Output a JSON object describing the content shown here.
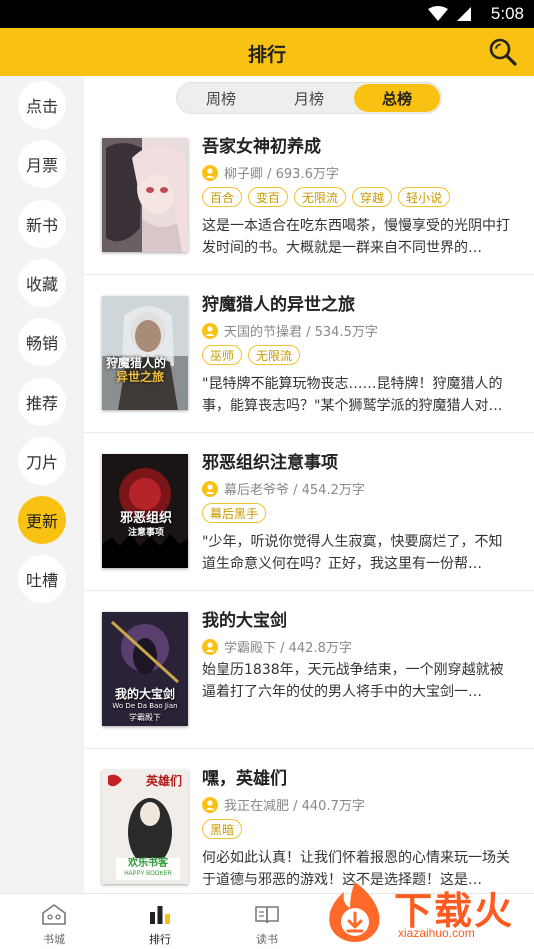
{
  "status_bar": {
    "time": "5:08"
  },
  "header": {
    "title": "排行"
  },
  "sidebar": {
    "items": [
      {
        "label": "点击",
        "active": false
      },
      {
        "label": "月票",
        "active": false
      },
      {
        "label": "新书",
        "active": false
      },
      {
        "label": "收藏",
        "active": false
      },
      {
        "label": "畅销",
        "active": false
      },
      {
        "label": "推荐",
        "active": false
      },
      {
        "label": "刀片",
        "active": false
      },
      {
        "label": "更新",
        "active": true
      },
      {
        "label": "吐槽",
        "active": false
      }
    ]
  },
  "segment": {
    "tabs": [
      {
        "label": "周榜",
        "active": false
      },
      {
        "label": "月榜",
        "active": false
      },
      {
        "label": "总榜",
        "active": true
      }
    ]
  },
  "books": [
    {
      "title": "吾家女神初养成",
      "author": "柳子卿 / 693.6万字",
      "tags": [
        "百合",
        "变百",
        "无限流",
        "穿越",
        "轻小说"
      ],
      "description": "这是一本适合在吃东西喝茶，慢慢享受的光阴中打发时间的书。大概就是一群来自不同世界的…"
    },
    {
      "title": "狩魔猎人的异世之旅",
      "author": "天国的节操君 / 534.5万字",
      "tags": [
        "巫师",
        "无限流"
      ],
      "description": "\"昆特牌不能算玩物丧志……昆特牌！狩魔猎人的事，能算丧志吗？\"某个狮鹫学派的狩魔猎人对…"
    },
    {
      "title": "邪恶组织注意事项",
      "author": "幕后老爷爷 / 454.2万字",
      "tags": [
        "幕后黑手"
      ],
      "description": "\"少年，听说你觉得人生寂寞，快要腐烂了，不知道生命意义何在吗？正好，我这里有一份帮…"
    },
    {
      "title": "我的大宝剑",
      "author": "学霸殿下 / 442.8万字",
      "tags": [],
      "description": "始皇历1838年，天元战争结束，一个刚穿越就被逼着打了六年的仗的男人将手中的大宝剑一…"
    },
    {
      "title": "嘿，英雄们",
      "author": "我正在减肥 / 440.7万字",
      "tags": [
        "黑暗"
      ],
      "description": "何必如此认真！让我们怀着报恩的心情来玩一场关于道德与邪恶的游戏！这不是选择题！这是…"
    }
  ],
  "covers": {
    "cover2": {
      "line1": "狩魔猎人的",
      "line2": "异世之旅"
    },
    "cover3": {
      "line1": "邪恶组织",
      "line2": "注意事项"
    },
    "cover4": {
      "line1": "我的大宝剑",
      "line2": "Wo De Da Bao Jian",
      "line3": "学霸殿下"
    },
    "cover5": {
      "line1": "英雄们",
      "line2": "欢乐书客",
      "line3": "HAPPY BOOKER"
    }
  },
  "bottom_nav": {
    "items": [
      {
        "label": "书城",
        "icon": "house-icon",
        "active": false
      },
      {
        "label": "排行",
        "icon": "bar-chart-icon",
        "active": true
      },
      {
        "label": "读书",
        "icon": "open-book-icon",
        "active": false
      }
    ]
  },
  "watermark": {
    "brand": "下载火",
    "url": "xiazaihuo.com"
  },
  "colors": {
    "accent": "#f9c213",
    "tag_border": "#f1c232",
    "tag_text": "#c99a00",
    "watermark": "#ff5a1f"
  }
}
